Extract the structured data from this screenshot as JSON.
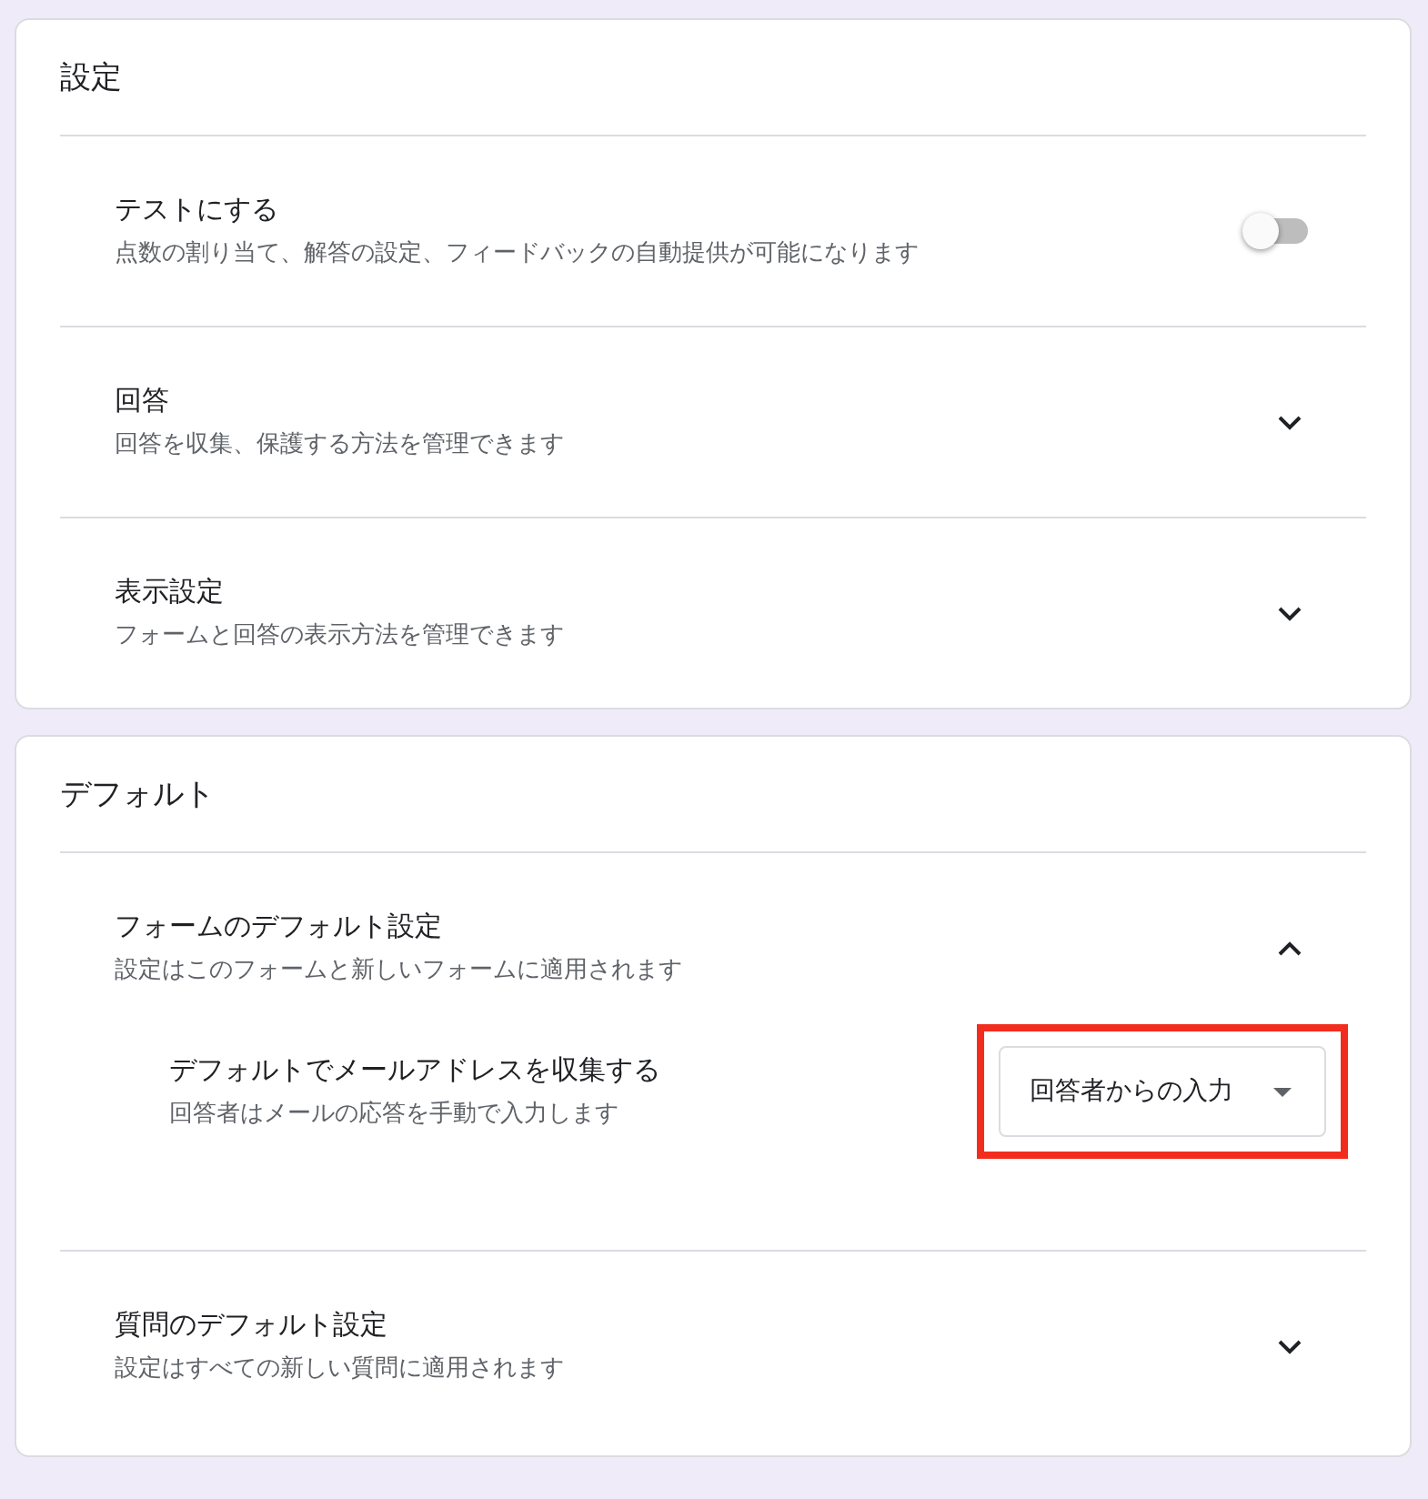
{
  "sections": [
    {
      "title": "設定",
      "rows": [
        {
          "kind": "toggle",
          "title": "テストにする",
          "subtitle": "点数の割り当て、解答の設定、フィードバックの自動提供が可能になります",
          "on": false
        },
        {
          "kind": "expander",
          "title": "回答",
          "subtitle": "回答を収集、保護する方法を管理できます",
          "expanded": false
        },
        {
          "kind": "expander",
          "title": "表示設定",
          "subtitle": "フォームと回答の表示方法を管理できます",
          "expanded": false
        }
      ]
    },
    {
      "title": "デフォルト",
      "rows": [
        {
          "kind": "expander",
          "title": "フォームのデフォルト設定",
          "subtitle": "設定はこのフォームと新しいフォームに適用されます",
          "expanded": true,
          "children": [
            {
              "kind": "select",
              "title": "デフォルトでメールアドレスを収集する",
              "subtitle": "回答者はメールの応答を手動で入力します",
              "value": "回答者からの入力",
              "highlighted": true
            }
          ]
        },
        {
          "kind": "expander",
          "title": "質問のデフォルト設定",
          "subtitle": "設定はすべての新しい質問に適用されます",
          "expanded": false
        }
      ]
    }
  ]
}
